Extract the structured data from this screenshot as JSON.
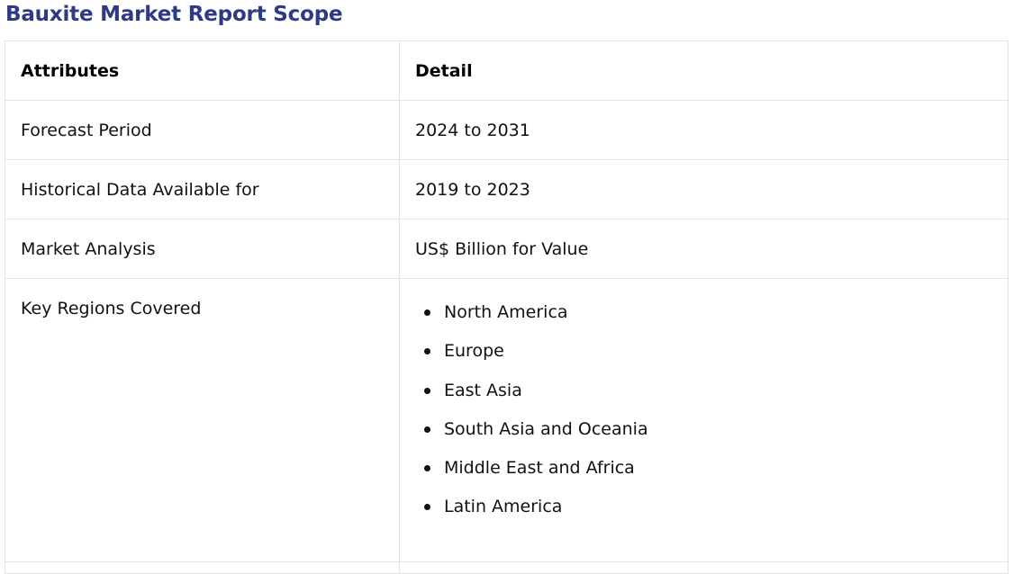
{
  "title": "Bauxite Market Report Scope",
  "table": {
    "headers": [
      "Attributes",
      "Detail"
    ],
    "rows": [
      {
        "attribute": "Forecast Period",
        "detail": "2024 to 2031"
      },
      {
        "attribute": "Historical Data Available for",
        "detail": "2019 to 2023"
      },
      {
        "attribute": "Market Analysis",
        "detail": "US$ Billion for Value"
      }
    ],
    "regions_row": {
      "attribute": "Key Regions Covered",
      "items": [
        "North America",
        "Europe",
        "East Asia",
        "South Asia and Oceania",
        "Middle East and Africa",
        "Latin America"
      ]
    }
  },
  "colors": {
    "title": "#2e3a87",
    "border": "#e3e3e3",
    "text": "#111111"
  }
}
